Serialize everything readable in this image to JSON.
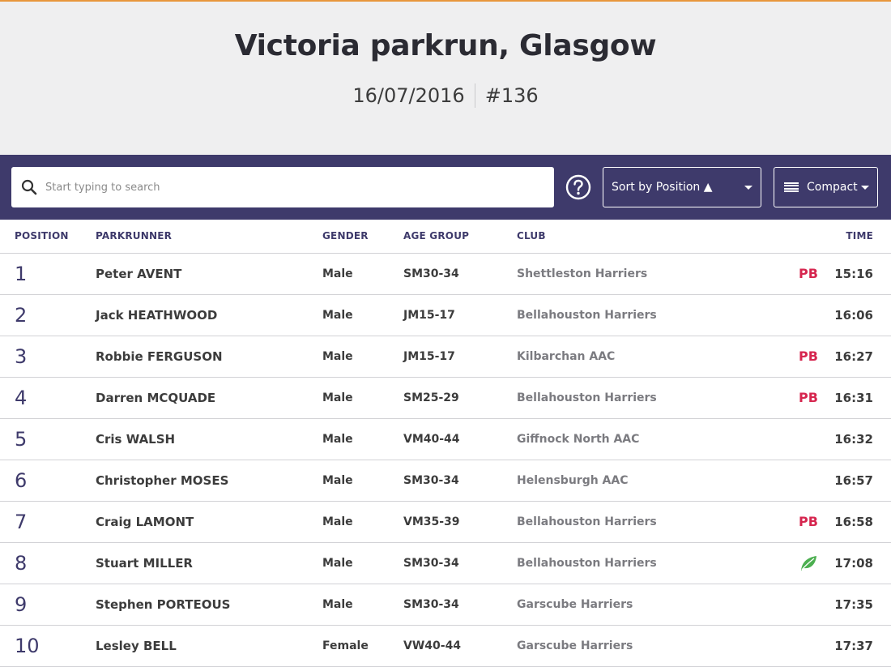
{
  "header": {
    "title": "Victoria parkrun, Glasgow",
    "date": "16/07/2016",
    "event_number": "#136"
  },
  "toolbar": {
    "search_placeholder": "Start typing to search",
    "sort_label": "Sort by Position ▲",
    "view_label": "Compact"
  },
  "columns": [
    "POSITION",
    "PARKRUNNER",
    "GENDER",
    "AGE GROUP",
    "CLUB",
    "TIME"
  ],
  "colors": {
    "toolbar_bg": "#3e3a6b",
    "header_bg": "#efeff0",
    "pb": "#d6264f",
    "first_timer_leaf": "#4caf50"
  },
  "rows": [
    {
      "position": "1",
      "name": "Peter AVENT",
      "gender": "Male",
      "age_group": "SM30-34",
      "club": "Shettleston Harriers",
      "badge": "PB",
      "time": "15:16"
    },
    {
      "position": "2",
      "name": "Jack HEATHWOOD",
      "gender": "Male",
      "age_group": "JM15-17",
      "club": "Bellahouston Harriers",
      "badge": "",
      "time": "16:06"
    },
    {
      "position": "3",
      "name": "Robbie FERGUSON",
      "gender": "Male",
      "age_group": "JM15-17",
      "club": "Kilbarchan AAC",
      "badge": "PB",
      "time": "16:27"
    },
    {
      "position": "4",
      "name": "Darren MCQUADE",
      "gender": "Male",
      "age_group": "SM25-29",
      "club": "Bellahouston Harriers",
      "badge": "PB",
      "time": "16:31"
    },
    {
      "position": "5",
      "name": "Cris WALSH",
      "gender": "Male",
      "age_group": "VM40-44",
      "club": "Giffnock North AAC",
      "badge": "",
      "time": "16:32"
    },
    {
      "position": "6",
      "name": "Christopher MOSES",
      "gender": "Male",
      "age_group": "SM30-34",
      "club": "Helensburgh AAC",
      "badge": "",
      "time": "16:57"
    },
    {
      "position": "7",
      "name": "Craig LAMONT",
      "gender": "Male",
      "age_group": "VM35-39",
      "club": "Bellahouston Harriers",
      "badge": "PB",
      "time": "16:58"
    },
    {
      "position": "8",
      "name": "Stuart MILLER",
      "gender": "Male",
      "age_group": "SM30-34",
      "club": "Bellahouston Harriers",
      "badge": "leaf-icon",
      "time": "17:08"
    },
    {
      "position": "9",
      "name": "Stephen PORTEOUS",
      "gender": "Male",
      "age_group": "SM30-34",
      "club": "Garscube Harriers",
      "badge": "",
      "time": "17:35"
    },
    {
      "position": "10",
      "name": "Lesley BELL",
      "gender": "Female",
      "age_group": "VW40-44",
      "club": "Garscube Harriers",
      "badge": "",
      "time": "17:37"
    }
  ]
}
